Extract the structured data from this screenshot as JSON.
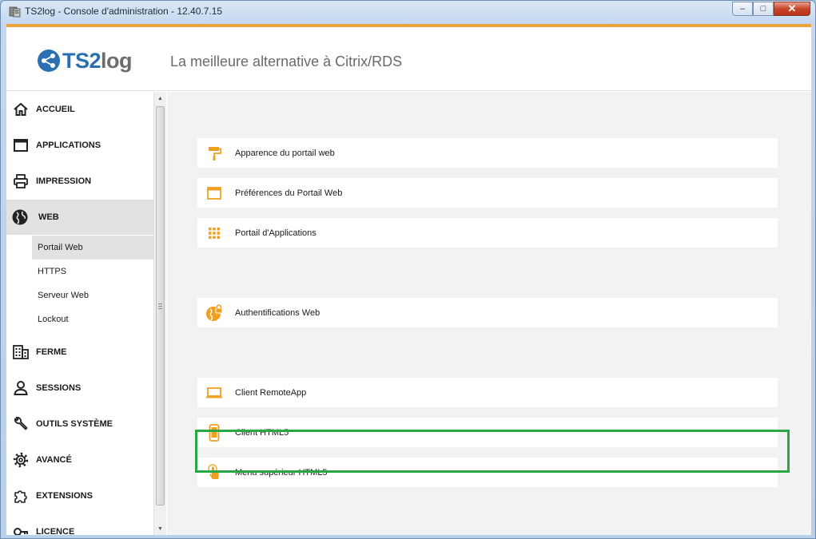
{
  "window": {
    "title": "TS2log - Console d'administration - 12.40.7.15",
    "minimize_glyph": "–",
    "maximize_glyph": "□",
    "close_glyph": "✕"
  },
  "header": {
    "logo_prefix": "TS",
    "logo_number": "2",
    "logo_suffix": "log",
    "tagline": "La meilleure alternative à Citrix/RDS"
  },
  "sidebar": {
    "items": [
      {
        "label": "ACCUEIL",
        "icon": "home-icon"
      },
      {
        "label": "APPLICATIONS",
        "icon": "window-icon"
      },
      {
        "label": "IMPRESSION",
        "icon": "printer-icon"
      },
      {
        "label": "WEB",
        "icon": "globe-icon"
      },
      {
        "label": "FERME",
        "icon": "building-icon"
      },
      {
        "label": "SESSIONS",
        "icon": "user-icon"
      },
      {
        "label": "OUTILS SYSTÈME",
        "icon": "wrench-icon"
      },
      {
        "label": "AVANCÉ",
        "icon": "gear-icon"
      },
      {
        "label": "EXTENSIONS",
        "icon": "puzzle-icon"
      },
      {
        "label": "LICENCE",
        "icon": "key-icon"
      }
    ],
    "web_subitems": [
      {
        "label": "Portail Web"
      },
      {
        "label": "HTTPS"
      },
      {
        "label": "Serveur Web"
      },
      {
        "label": "Lockout"
      }
    ]
  },
  "main": {
    "cards": [
      {
        "label": "Apparence du portail web",
        "icon": "paint-roller-icon"
      },
      {
        "label": "Préférences du Portail Web",
        "icon": "browser-window-icon"
      },
      {
        "label": "Portail d'Applications",
        "icon": "grid-icon"
      },
      {
        "label": "Authentifications Web",
        "icon": "globe-lock-icon"
      },
      {
        "label": "Client RemoteApp",
        "icon": "laptop-icon"
      },
      {
        "label": "Client HTML5",
        "icon": "mobile-icon"
      },
      {
        "label": "Menu supérieur HTML5",
        "icon": "touch-icon"
      }
    ]
  },
  "colors": {
    "accent_orange": "#e8a33a",
    "highlight_green": "#27a845",
    "logo_blue": "#2a6fb0"
  }
}
